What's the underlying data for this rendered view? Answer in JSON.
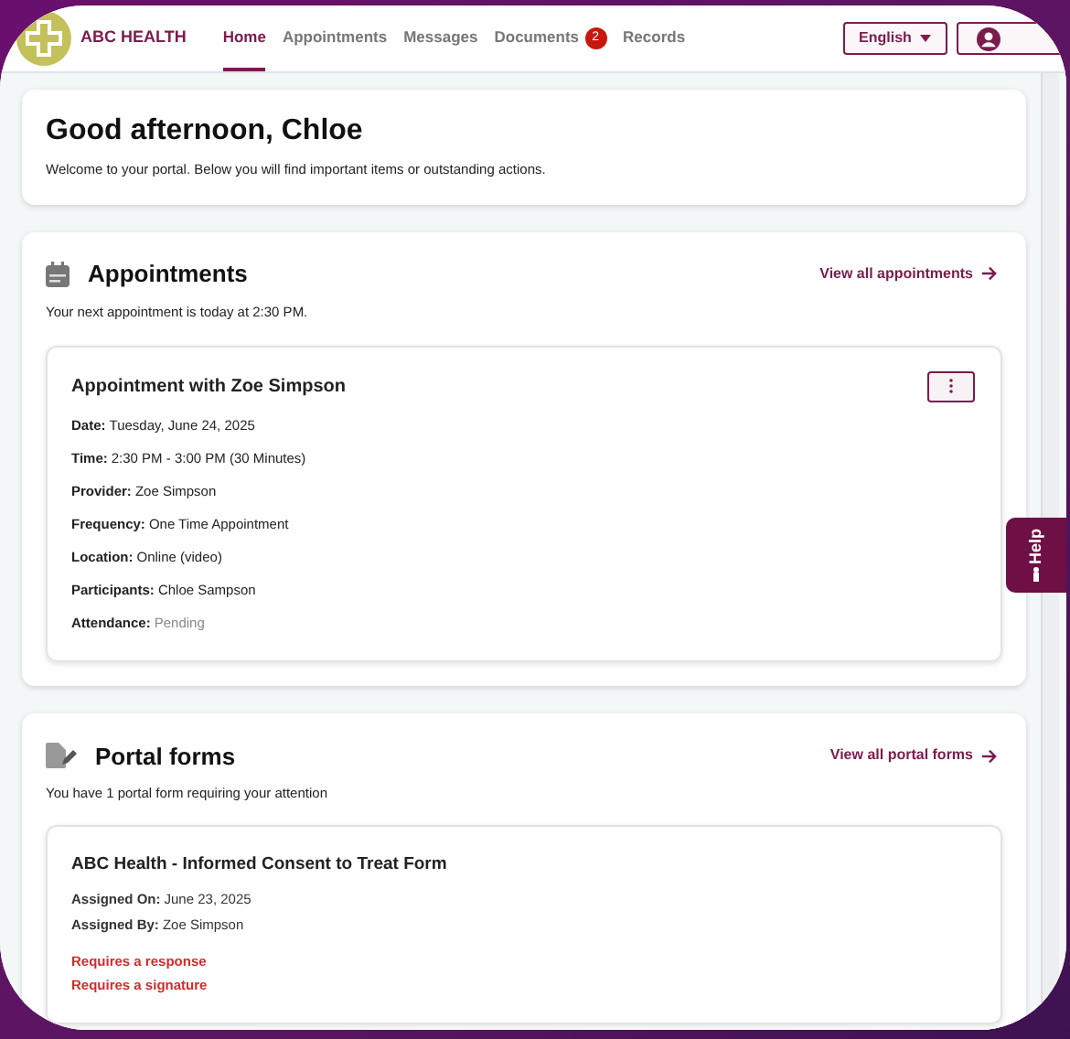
{
  "brand": {
    "name": "ABC HEALTH"
  },
  "nav": [
    {
      "label": "Home",
      "selected": true
    },
    {
      "label": "Appointments",
      "selected": false
    },
    {
      "label": "Messages",
      "selected": false
    },
    {
      "label": "Documents",
      "selected": false,
      "badge": "2"
    },
    {
      "label": "Records",
      "selected": false
    }
  ],
  "language_button": {
    "label": "English"
  },
  "greeting": {
    "title": "Good afternoon, Chloe",
    "text": "Welcome to your portal. Below you will find important items or outstanding actions."
  },
  "appointments": {
    "title": "Appointments",
    "link": "View all appointments",
    "subtitle": "Your next appointment is today at 2:30 PM.",
    "card": {
      "title": "Appointment with Zoe Simpson",
      "rows": [
        {
          "label": "Date:",
          "value": "Tuesday, June 24, 2025",
          "muted": false
        },
        {
          "label": "Time:",
          "value": "2:30 PM - 3:00 PM (30 Minutes)",
          "muted": false
        },
        {
          "label": "Provider:",
          "value": "Zoe Simpson",
          "muted": false
        },
        {
          "label": "Frequency:",
          "value": "One Time Appointment",
          "muted": false
        },
        {
          "label": "Location:",
          "value": "Online (video)",
          "muted": false
        },
        {
          "label": "Participants:",
          "value": "Chloe Sampson",
          "muted": false
        },
        {
          "label": "Attendance:",
          "value": "Pending",
          "muted": true
        }
      ]
    }
  },
  "portal_forms": {
    "title": "Portal forms",
    "link": "View all portal forms",
    "subtitle": "You have 1 portal form requiring your attention",
    "card": {
      "title": "ABC Health - Informed Consent to Treat Form",
      "rows": [
        {
          "label": "Assigned On:",
          "value": "June 23, 2025"
        },
        {
          "label": "Assigned By:",
          "value": "Zoe Simpson"
        }
      ],
      "requirements": [
        "Requires a response",
        "Requires a signature"
      ]
    }
  },
  "help_tab": {
    "label": "Help"
  }
}
